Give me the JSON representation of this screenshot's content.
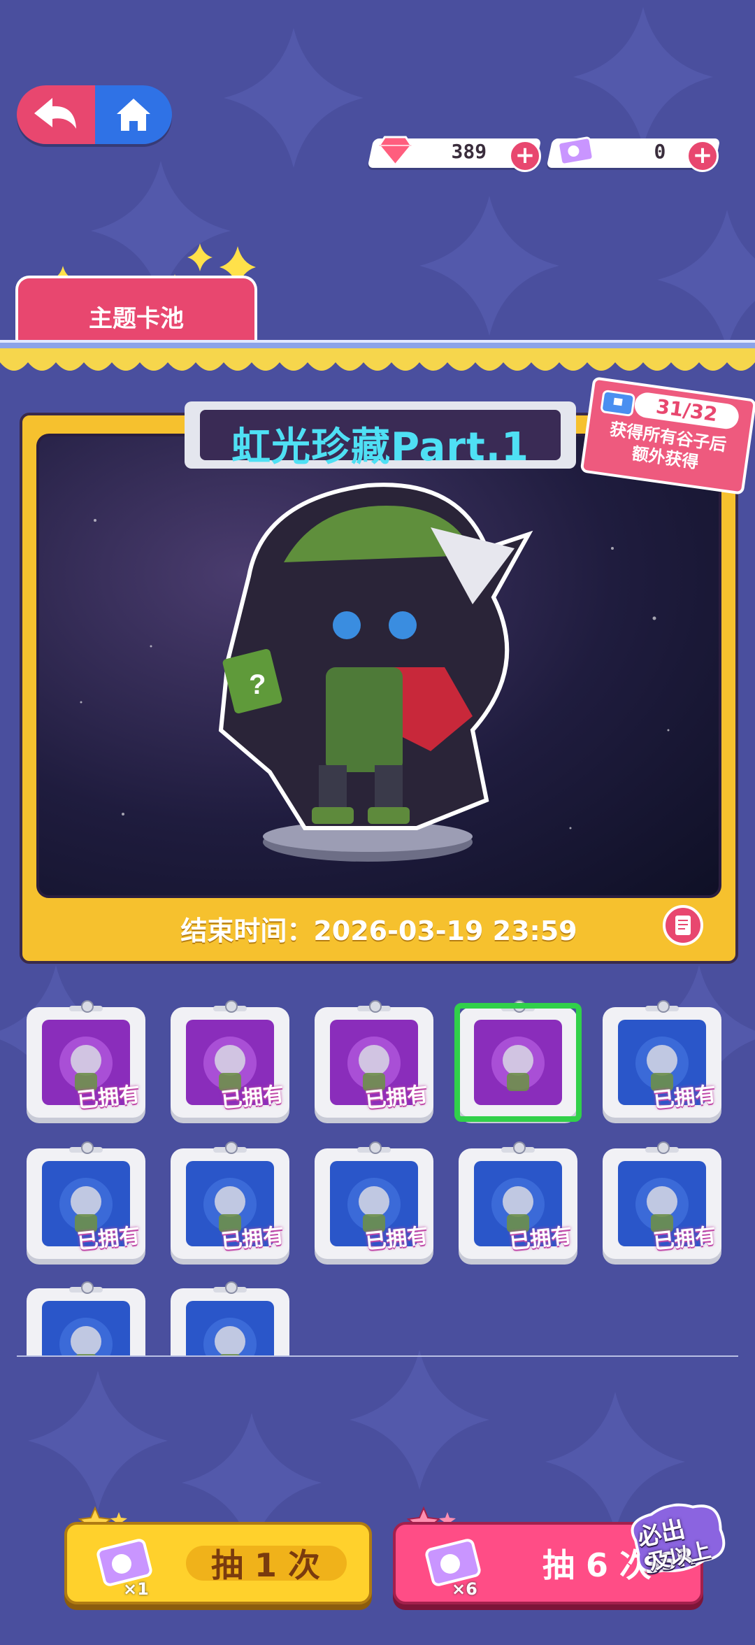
{
  "currency": {
    "gems": "389",
    "tickets": "0"
  },
  "tab": {
    "label": "主题卡池"
  },
  "banner": {
    "title": "虹光珍藏Part.1",
    "end_time": "结束时间：2026-03-19 23:59",
    "progress": "31/32",
    "reward_line1": "获得所有谷子后",
    "reward_line2": "额外获得"
  },
  "collection": {
    "owned_label": "已拥有",
    "items": [
      {
        "style": "purple",
        "owned": true
      },
      {
        "style": "purple",
        "owned": true
      },
      {
        "style": "purple",
        "owned": true
      },
      {
        "style": "purple",
        "owned": false,
        "selected": true
      },
      {
        "style": "blue",
        "owned": true
      },
      {
        "style": "blue",
        "owned": true
      },
      {
        "style": "blue",
        "owned": true
      },
      {
        "style": "blue",
        "owned": true
      },
      {
        "style": "blue",
        "owned": true
      },
      {
        "style": "blue",
        "owned": true
      },
      {
        "style": "blue",
        "owned": false
      },
      {
        "style": "blue",
        "owned": false
      }
    ]
  },
  "actions": {
    "draw_one": {
      "label": "抽 1 次",
      "multiplier": "×1"
    },
    "draw_six": {
      "label": "抽 6 次",
      "multiplier": "×6"
    },
    "ssr_badge_line1": "必出SSR",
    "ssr_badge_line2": "及以上"
  },
  "icons": {
    "back": "back-arrow-icon",
    "home": "home-icon",
    "gem": "gem-icon",
    "ticket": "ticket-icon",
    "plus": "plus-icon",
    "rules": "document-icon"
  },
  "colors": {
    "background": "#4a4f9e",
    "pink": "#e8476f",
    "yellow": "#f6c12e",
    "title_cyan": "#4fe0f4",
    "selected_green": "#31d04a"
  }
}
